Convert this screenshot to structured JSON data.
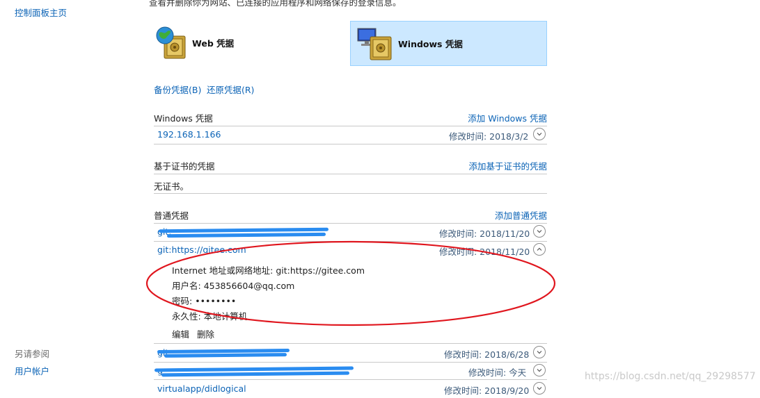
{
  "sidebar": {
    "home_label": "控制面板主页",
    "see_also_label": "另请参阅",
    "user_accounts_label": "用户帐户"
  },
  "header": {
    "description": "查看并删除你为网站、已连接的应用程序和网络保存的登录信息。"
  },
  "tiles": [
    {
      "label": "Web 凭据",
      "icon": "globe-vault-icon",
      "selected": false
    },
    {
      "label": "Windows 凭据",
      "icon": "monitor-vault-icon",
      "selected": true
    }
  ],
  "actions": {
    "backup_label": "备份凭据(B)",
    "restore_label": "还原凭据(R)"
  },
  "windows_credentials": {
    "title": "Windows 凭据",
    "add_label": "添加 Windows 凭据",
    "items": [
      {
        "name": "192.168.1.166",
        "modified": "修改时间:  2018/3/2"
      }
    ]
  },
  "cert_credentials": {
    "title": "基于证书的凭据",
    "add_label": "添加基于证书的凭据",
    "empty_text": "无证书。"
  },
  "generic_credentials": {
    "title": "普通凭据",
    "add_label": "添加普通凭据",
    "items": [
      {
        "name": "git:",
        "modified": "修改时间:  2018/11/20",
        "redacted": true
      },
      {
        "name": "git:https://gitee.com",
        "modified": "修改时间:  2018/11/20",
        "expanded": true
      },
      {
        "name": "git",
        "modified": "修改时间:  2018/6/28",
        "redacted": true
      },
      {
        "name": "g",
        "modified": "修改时间:  今天",
        "redacted": true
      },
      {
        "name": "virtualapp/didlogical",
        "modified": "修改时间:  2018/9/20"
      }
    ],
    "expanded_detail": {
      "address_label": "Internet 地址或网络地址:",
      "address_value": "git:https://gitee.com",
      "username_label": "用户名:",
      "username_value": "453856604@qq.com",
      "password_label": "密码:",
      "password_value": "••••••••",
      "persistence_label": "永久性:",
      "persistence_value": "本地计算机",
      "edit_label": "编辑",
      "delete_label": "删除"
    }
  },
  "annotation_color": "#e0161e",
  "watermark": "https://blog.csdn.net/qq_29298577"
}
